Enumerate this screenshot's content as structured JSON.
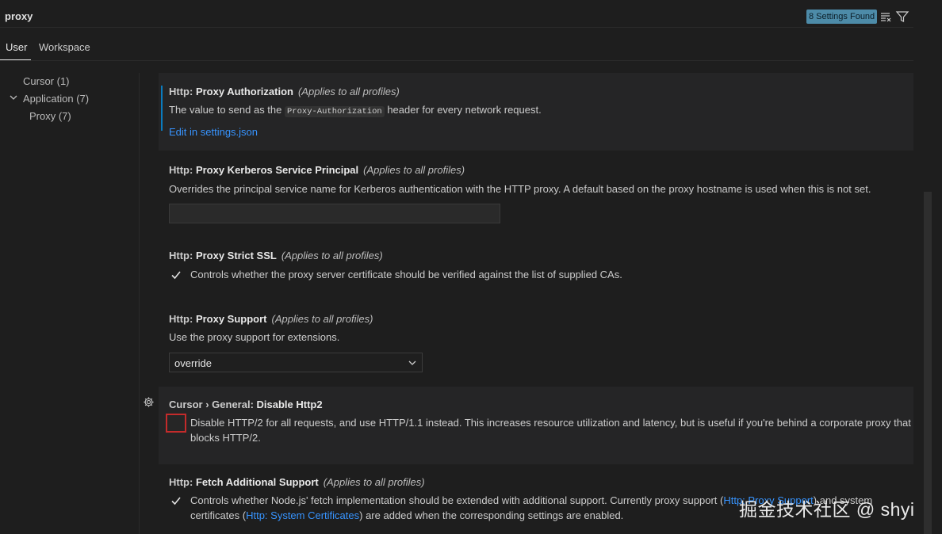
{
  "search": {
    "query": "proxy",
    "results_badge": "8 Settings Found"
  },
  "tabs": [
    {
      "label": "User"
    },
    {
      "label": "Workspace"
    }
  ],
  "tree": [
    {
      "label": "Cursor (1)"
    },
    {
      "label": "Application (7)"
    },
    {
      "label": "Proxy (7)"
    }
  ],
  "settings": {
    "proxy_authorization": {
      "category": "Http: ",
      "name": "Proxy Authorization",
      "scope": "(Applies to all profiles)",
      "desc_before": "The value to send as the ",
      "code": "Proxy-Authorization",
      "desc_after": " header for every network request.",
      "link": "Edit in settings.json"
    },
    "kerberos": {
      "category": "Http: ",
      "name": "Proxy Kerberos Service Principal",
      "scope": "(Applies to all profiles)",
      "desc": "Overrides the principal service name for Kerberos authentication with the HTTP proxy. A default based on the proxy hostname is used when this is not set.",
      "value": ""
    },
    "strict_ssl": {
      "category": "Http: ",
      "name": "Proxy Strict SSL",
      "scope": "(Applies to all profiles)",
      "desc": "Controls whether the proxy server certificate should be verified against the list of supplied CAs.",
      "checked": true
    },
    "proxy_support": {
      "category": "Http: ",
      "name": "Proxy Support",
      "scope": "(Applies to all profiles)",
      "desc": "Use the proxy support for extensions.",
      "value": "override"
    },
    "disable_http2": {
      "category": "Cursor › General: ",
      "name": "Disable Http2",
      "desc_line1": "Disable HTTP/2 for all requests, and use HTTP/1.1 instead. This increases resource utilization and latency, but is useful if you're behind a corporate proxy that",
      "desc_line2": "blocks HTTP/2.",
      "checked": false
    },
    "fetch_support": {
      "category": "Http: ",
      "name": "Fetch Additional Support",
      "scope": "(Applies to all profiles)",
      "line1_before": "Controls whether Node.js' fetch implementation should be extended with additional support. Currently proxy support (",
      "line1_link": "Http: Proxy Support",
      "line1_after": ") and system",
      "line2_before": "certificates (",
      "line2_link": "Http: System Certificates",
      "line2_after": ") are added when the corresponding settings are enabled.",
      "checked": true
    }
  },
  "watermark": "掘金技术社区 @ shyi"
}
